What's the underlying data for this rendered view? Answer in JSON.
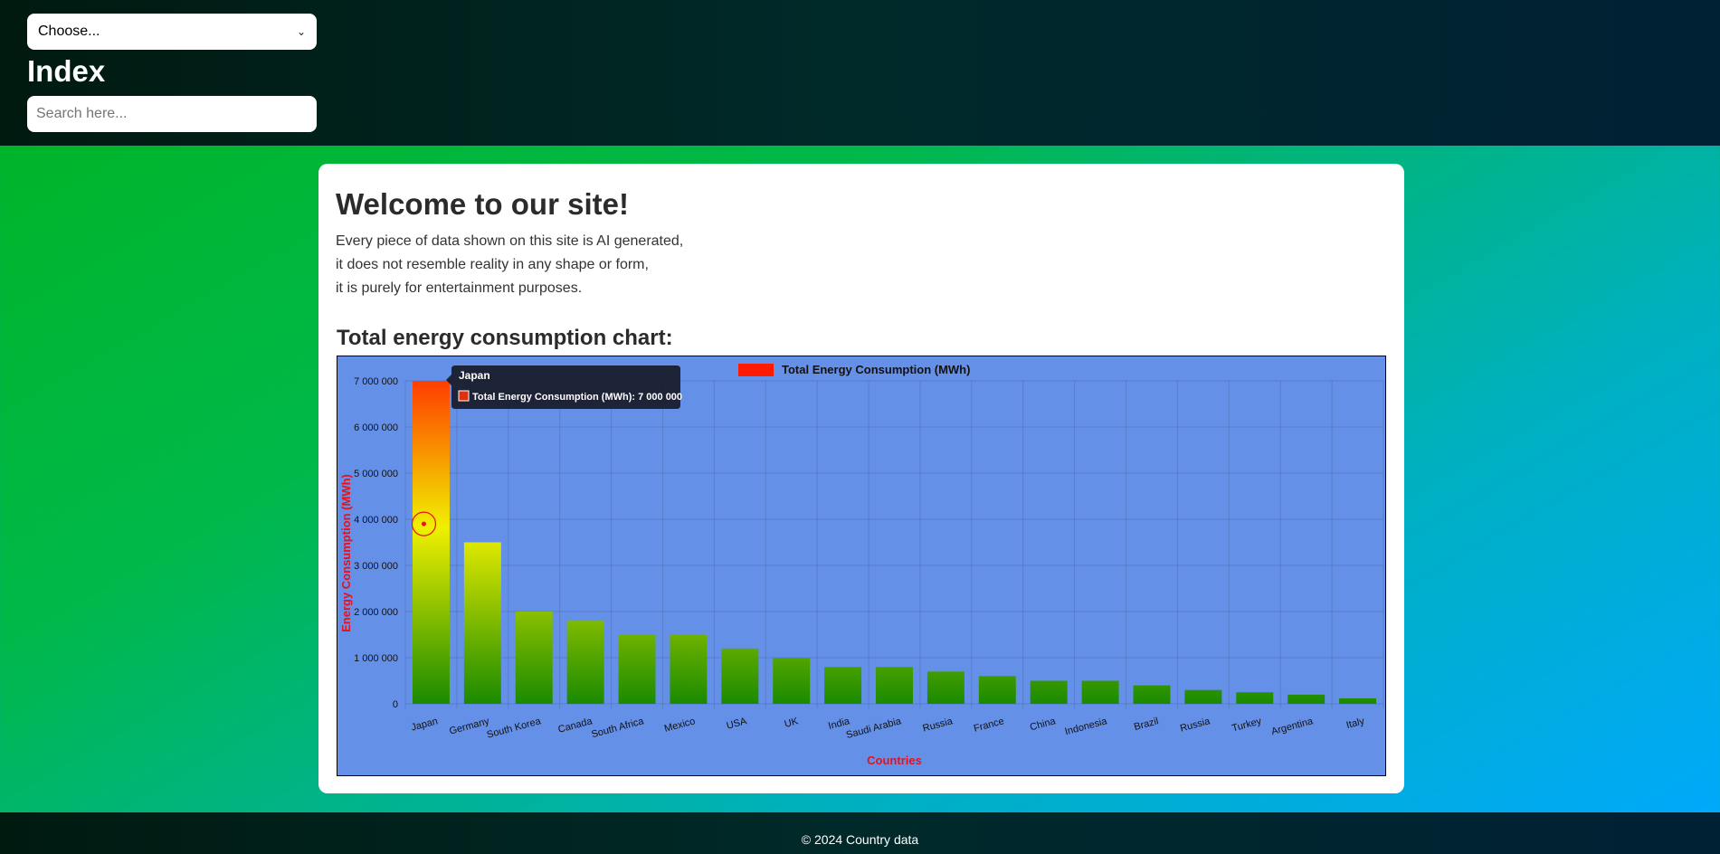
{
  "header": {
    "select_value": "Choose...",
    "title": "Index",
    "search_placeholder": "Search here..."
  },
  "main": {
    "welcome": "Welcome to our site!",
    "intro_lines": [
      "Every piece of data shown on this site is AI generated,",
      "it does not resemble reality in any shape or form,",
      "it is purely for entertainment purposes."
    ],
    "chart_heading": "Total energy consumption chart:"
  },
  "chart_data": {
    "type": "bar",
    "categories": [
      "Japan",
      "Germany",
      "South Korea",
      "Canada",
      "South Africa",
      "Mexico",
      "USA",
      "UK",
      "India",
      "Saudi Arabia",
      "Russia",
      "France",
      "China",
      "Indonesia",
      "Brazil",
      "Russia",
      "Turkey",
      "Argentina",
      "Italy"
    ],
    "series": [
      {
        "name": "Total Energy Consumption (MWh)",
        "values": [
          7000000,
          3500000,
          2000000,
          1800000,
          1500000,
          1500000,
          1200000,
          1000000,
          800000,
          800000,
          700000,
          600000,
          500000,
          500000,
          400000,
          300000,
          250000,
          200000,
          120000
        ]
      }
    ],
    "xlabel": "Countries",
    "ylabel": "Energy Consumption (MWh)",
    "ylim": [
      0,
      7000000
    ],
    "yticks": [
      "0",
      "1 000 000",
      "2 000 000",
      "3 000 000",
      "4 000 000",
      "5 000 000",
      "6 000 000",
      "7 000 000"
    ],
    "grid": true,
    "legend": "top",
    "tooltip": {
      "title": "Japan",
      "text": "Total Energy Consumption (MWh): 7 000 000"
    },
    "colors": {
      "background": "#6590e8",
      "legend_swatch": "#ff1a00",
      "bar_top": "#ff4000",
      "bar_mid": "#f0f000",
      "bar_bottom": "#1a8a00",
      "axis_title": "#e8101a"
    }
  },
  "footer": {
    "text": "© 2024 Country data"
  }
}
